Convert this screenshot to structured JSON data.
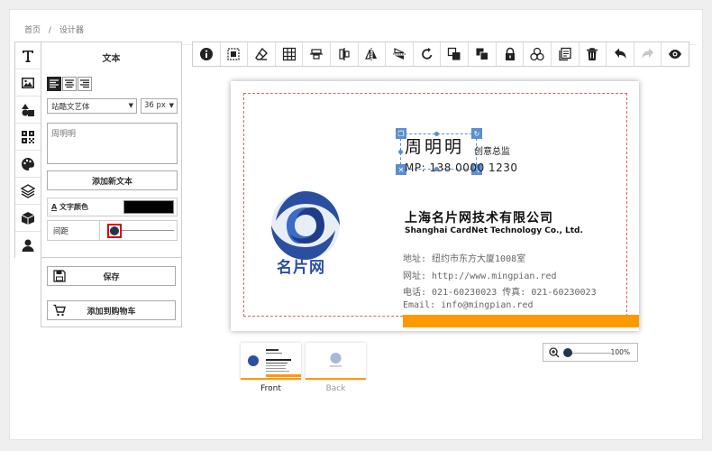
{
  "breadcrumb": {
    "home": "首页",
    "separator": "/",
    "current": "设计器"
  },
  "sidebar": {
    "icons": [
      "text-icon",
      "image-icon",
      "shapes-icon",
      "qrcode-icon",
      "palette-icon",
      "layers-icon",
      "box-icon",
      "user-icon"
    ],
    "active": "text-icon"
  },
  "text_panel": {
    "title": "文本",
    "font": "站酷文艺体",
    "font_size": "36 px",
    "text_value": "周明明",
    "add_text_label": "添加新文本",
    "color_label": "文字颜色",
    "color_value": "#000000",
    "spacing_label": "间距",
    "spacing_value": 0
  },
  "actions": {
    "save_label": "保存",
    "cart_label": "添加到购物车"
  },
  "toolbar": [
    "info-icon",
    "select-all-icon",
    "eraser-icon",
    "grid-icon",
    "align-vertical-center-icon",
    "align-horizontal-center-icon",
    "flip-horizontal-icon",
    "flip-vertical-icon",
    "rotate-icon",
    "bring-forward-icon",
    "send-backward-icon",
    "lock-icon",
    "group-icon",
    "copy-icon",
    "delete-icon",
    "undo-icon",
    "redo-icon",
    "preview-icon"
  ],
  "card": {
    "name": "周明明",
    "title": "创意总监",
    "mobile": "MP: 138 0000 1230",
    "company_cn": "上海名片网技术有限公司",
    "company_en": "Shanghai CardNet Technology Co., Ltd.",
    "address": "地址: 纽约市东方大厦1008室",
    "website": "网址: http://www.mingpian.red",
    "phone": "电话: 021-60230023  传真: 021-60230023",
    "email": "Email: info@mingpian.red",
    "logo_text": "名片网",
    "accent_color": "#ff9900",
    "logo_color": "#2a4fa0"
  },
  "pages": [
    {
      "label": "Front",
      "active": true
    },
    {
      "label": "Back",
      "active": false
    }
  ],
  "zoom": {
    "value": "100%",
    "level": 0
  }
}
